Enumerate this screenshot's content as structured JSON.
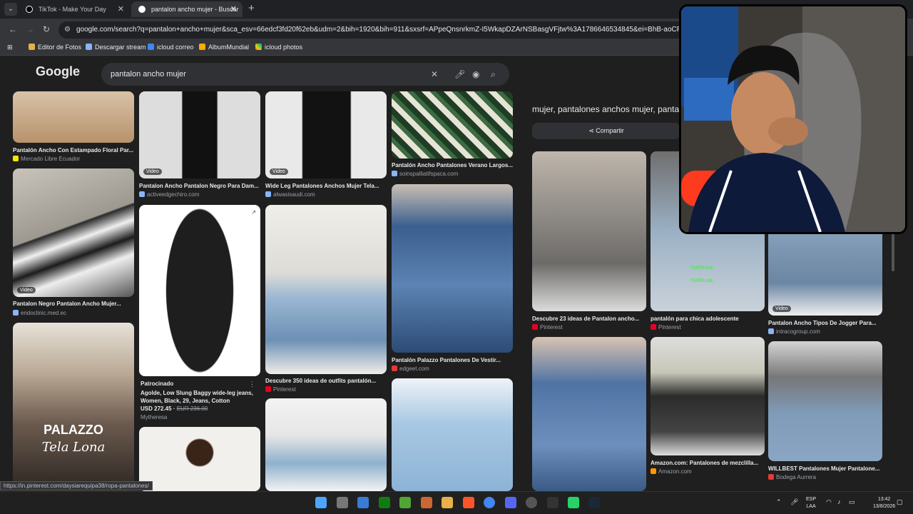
{
  "browser": {
    "tabs": [
      {
        "title": "TikTok - Make Your Day",
        "active": false
      },
      {
        "title": "pantalon ancho mujer - Buscar",
        "active": true
      }
    ],
    "url": "google.com/search?q=pantalon+ancho+mujer&sca_esv=66edcf3fd20f62eb&udm=2&bih=1920&bih=911&sxsrf=APpeQnsnrkmZ-I5WkapDZArNSBasgVFjtw%3A1786646534845&ei=BhB-aoCPM_GXwbkPl8",
    "bookmarks": [
      "Editor de Fotos",
      "Descargar stream",
      "icloud correo",
      "AlbumMundial",
      "icloud photos"
    ]
  },
  "google": {
    "logo": "Google",
    "query": "pantalon ancho mujer"
  },
  "results": {
    "col1": [
      {
        "title": "Pantalón Ancho Con Estampado Floral Par...",
        "source": "Mercado Libre Ecuador"
      },
      {
        "title": "Pantalon Negro Pantalon Ancho Mujer...",
        "source": "endoclinic.med.ec",
        "badge": "Video"
      },
      {
        "overlay": "PALAZZO",
        "overlay2": "Tela Lona"
      }
    ],
    "col2": [
      {
        "title": "Pantalon Ancho Pantalon Negro Para Dam...",
        "source": "activeedgechiro.com",
        "badge": "Video"
      },
      {
        "sponsored": "Patrocinado",
        "title": "Agolde, Low Slung Baggy wide-leg jeans, Women, Black, 29, Jeans, Cotton",
        "price": "USD 272.45",
        "oldprice": "EUR 236.00",
        "source": "Mytheresa"
      }
    ],
    "col3": [
      {
        "title": "Wide Leg Pantalones Anchos Mujer Tela...",
        "source": "alwasisaudi.com",
        "badge": "Video"
      },
      {
        "title": "Descubre 350 ideas de outfits pantalón...",
        "source": "Pinterest"
      }
    ],
    "col4": [
      {
        "title": "Pantalón Ancho Pantalones Verano Largos...",
        "source": "soinspalliatifspaca.com"
      },
      {
        "title": "Pantalón Palazzo Pantalones De Vestir...",
        "source": "edgeet.com"
      }
    ]
  },
  "side": {
    "heading": "mujer, pantalones anchos mujer, panta",
    "share": "Compartir",
    "related": [
      {
        "title": "Descubre 23 ideas de Pantalon ancho...",
        "source": "Pinterest"
      },
      {
        "title": "pantalón para chica adolescente",
        "source": "Pinterest"
      },
      {
        "title": "Pantalon Ancho Tipos De Jogger Para...",
        "source": "intracogroup.com",
        "badge": "Video"
      },
      {
        "title": "Amazon.com: Pantalones de mezclilla...",
        "source": "Amazon.com"
      },
      {
        "title": "WILLBEST Pantalones Mujer Pantalone...",
        "source": "Bodega Aurrera"
      }
    ],
    "chat": [
      "mathuaa",
      "mathuaa"
    ]
  },
  "status_url": "https://in.pinterest.com/daysiarequipa38/ropa-pantalones/",
  "tray": {
    "lang": "ESP",
    "layout": "LAA",
    "time": "13:42",
    "date": "13/8/2026"
  }
}
